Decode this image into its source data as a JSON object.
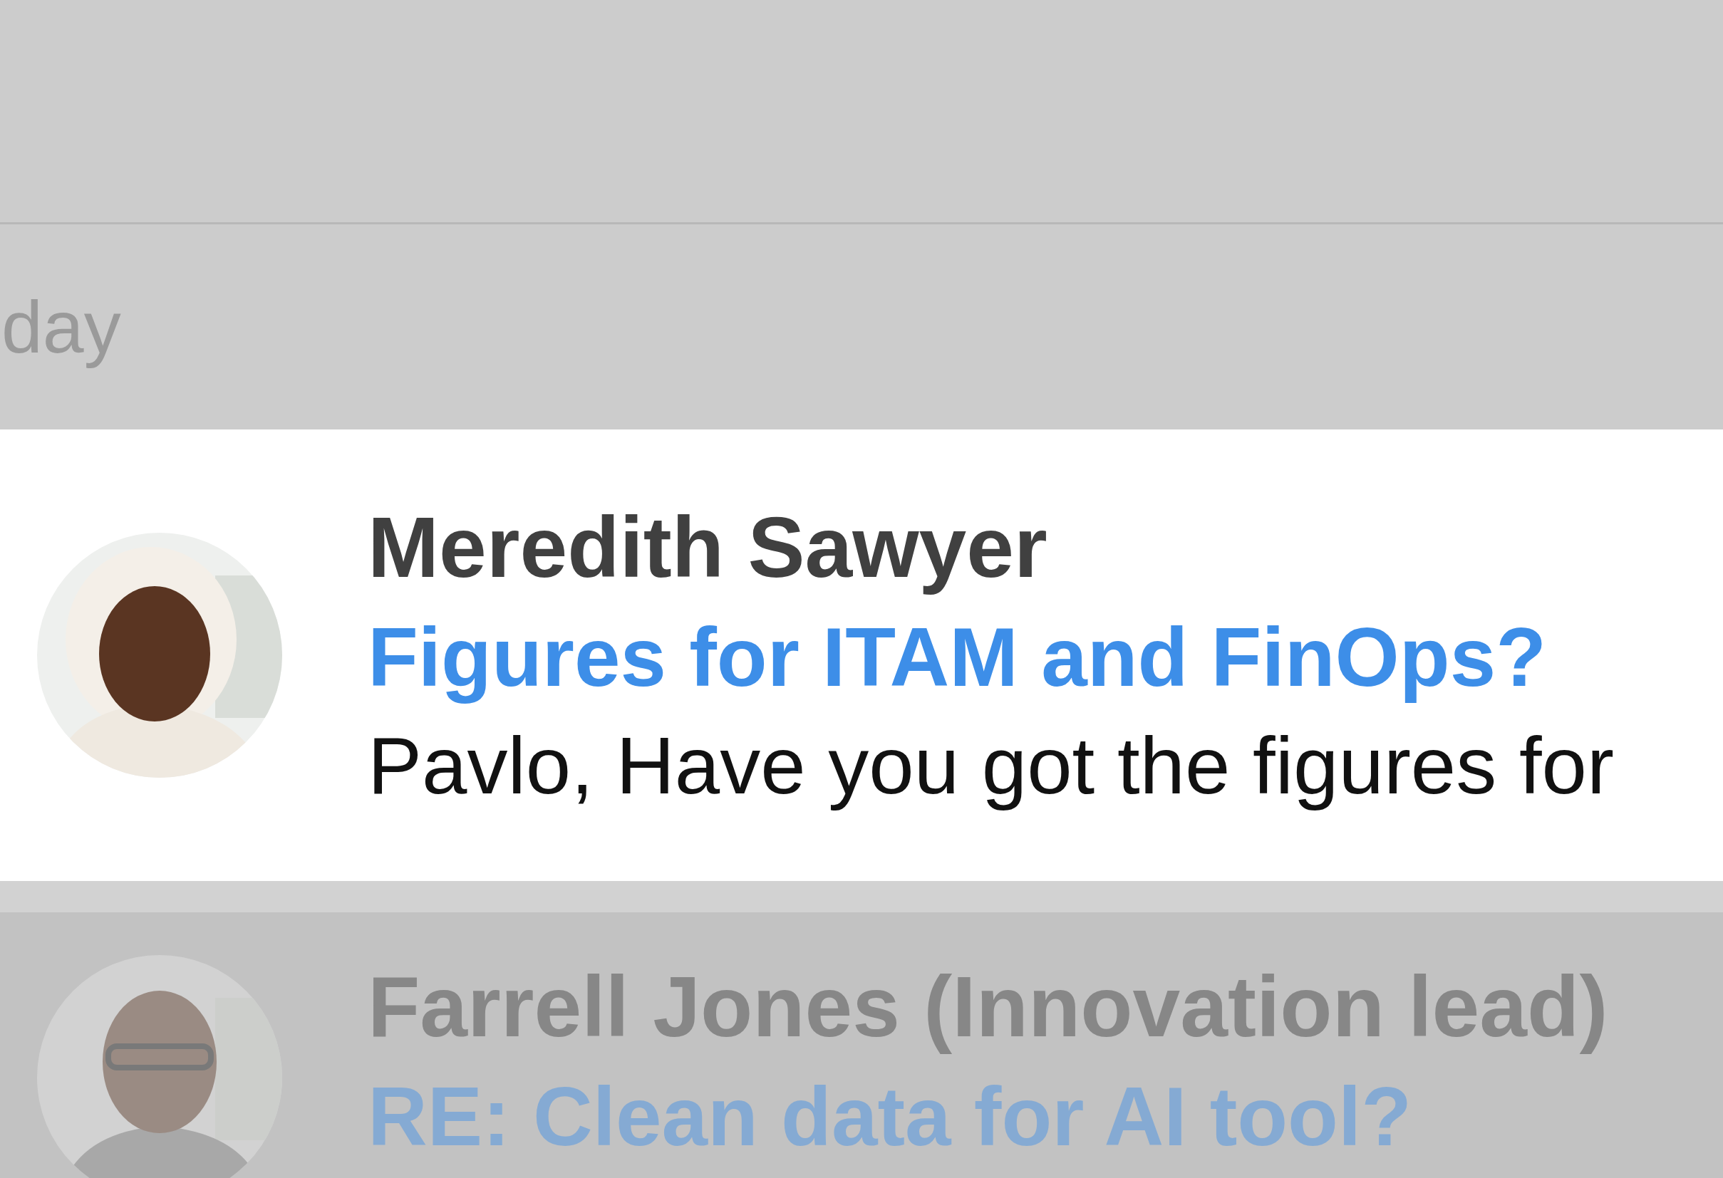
{
  "section_header": "day",
  "emails": [
    {
      "sender": "Meredith Sawyer",
      "subject": "Figures for ITAM and FinOps?",
      "preview": "Pavlo, Have you got the figures for",
      "highlighted": true
    },
    {
      "sender": "Farrell Jones (Innovation lead)",
      "subject": "RE: Clean data for AI tool?",
      "highlighted": false
    }
  ]
}
